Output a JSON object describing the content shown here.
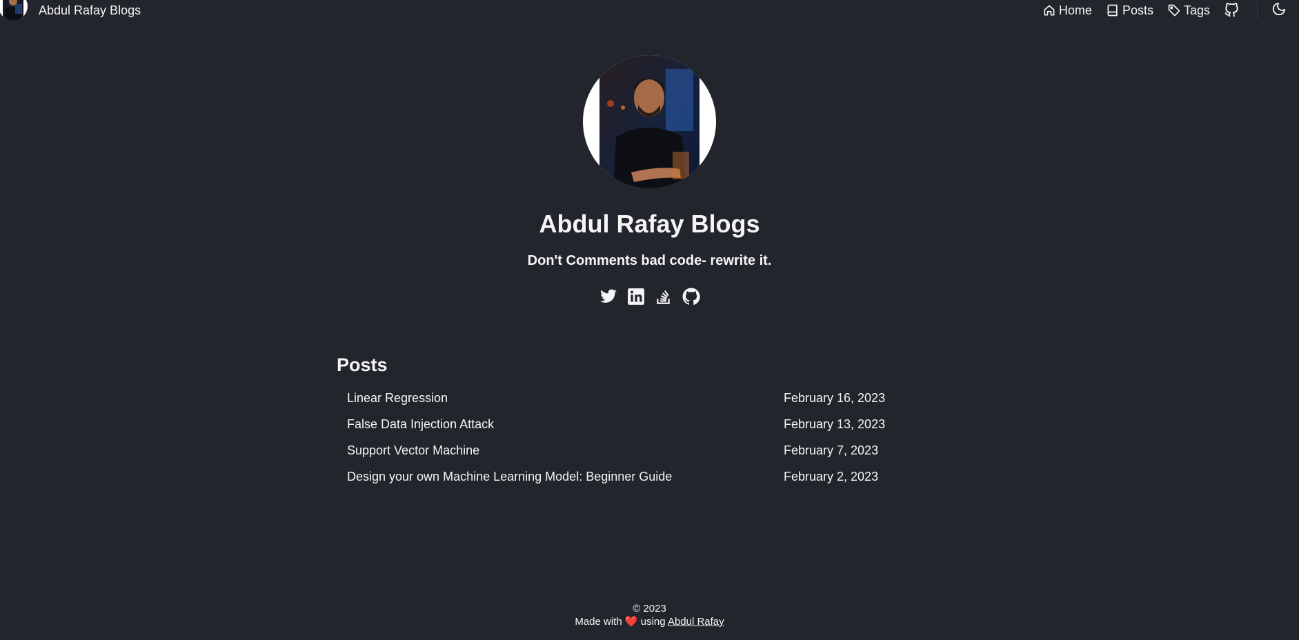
{
  "site": {
    "title": "Abdul Rafay Blogs"
  },
  "nav": {
    "items": [
      {
        "label": "Home",
        "icon": "home-icon"
      },
      {
        "label": "Posts",
        "icon": "book-icon"
      },
      {
        "label": "Tags",
        "icon": "tag-icon"
      }
    ],
    "github_icon": "github-icon",
    "theme_icon": "moon-icon"
  },
  "hero": {
    "title": "Abdul Rafay Blogs",
    "subtitle": "Don't Comments bad code- rewrite it.",
    "social": [
      "twitter-icon",
      "linkedin-icon",
      "stackoverflow-icon",
      "github-icon"
    ]
  },
  "posts": {
    "heading": "Posts",
    "items": [
      {
        "title": "Linear Regression",
        "date": "February 16, 2023"
      },
      {
        "title": "False Data Injection Attack",
        "date": "February 13, 2023"
      },
      {
        "title": "Support Vector Machine",
        "date": "February 7, 2023"
      },
      {
        "title": "Design your own Machine Learning Model: Beginner Guide",
        "date": "February 2, 2023"
      }
    ]
  },
  "footer": {
    "copyright": "© 2023",
    "made_with": "Made with",
    "heart": "❤️",
    "using": "using",
    "author": "Abdul Rafay"
  },
  "colors": {
    "background": "#22252b",
    "text": "#f5f5f5",
    "heart": "#e03131"
  }
}
